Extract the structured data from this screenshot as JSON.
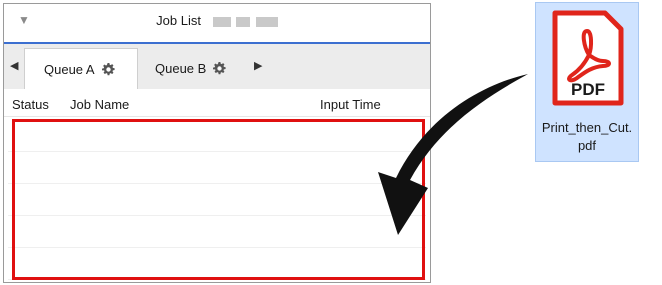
{
  "job_list": {
    "title": "Job List",
    "tabs": [
      {
        "label": "Queue A",
        "active": true
      },
      {
        "label": "Queue B",
        "active": false
      }
    ],
    "columns": [
      "Status",
      "Job Name",
      "Input Time"
    ],
    "rows": []
  },
  "file": {
    "icon_label": "PDF",
    "name_line1": "Print_then_Cut.",
    "name_line2": "pdf"
  },
  "colors": {
    "accent_blue": "#3c6fd0",
    "highlight_red": "#e01010",
    "pdf_red": "#e0251b",
    "file_selection": "#cfe3ff"
  }
}
